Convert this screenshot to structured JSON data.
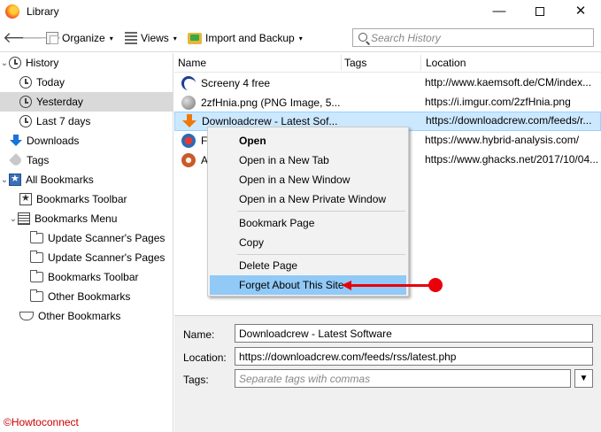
{
  "window": {
    "title": "Library",
    "min_glyph": "—",
    "close_glyph": "✕"
  },
  "toolbar": {
    "back_glyph": "🡐",
    "forward_glyph": "🡒",
    "organize_label": "Organize",
    "views_label": "Views",
    "import_label": "Import and Backup",
    "caret": "▾",
    "search_placeholder": "Search History"
  },
  "sidebar": {
    "items": [
      {
        "label": "History"
      },
      {
        "label": "Today"
      },
      {
        "label": "Yesterday"
      },
      {
        "label": "Last 7 days"
      },
      {
        "label": "Downloads"
      },
      {
        "label": "Tags"
      },
      {
        "label": "All Bookmarks"
      },
      {
        "label": "Bookmarks Toolbar"
      },
      {
        "label": "Bookmarks Menu"
      },
      {
        "label": "Update Scanner's Pages"
      },
      {
        "label": "Update Scanner's Pages"
      },
      {
        "label": "Bookmarks Toolbar"
      },
      {
        "label": "Other Bookmarks"
      },
      {
        "label": "Other Bookmarks"
      }
    ],
    "selected": "Yesterday"
  },
  "list": {
    "columns": [
      "Name",
      "Tags",
      "Location"
    ],
    "rows": [
      {
        "name": "Screeny 4 free",
        "tags": "",
        "location": "http://www.kaemsoft.de/CM/index...",
        "icon": "screeny-favicon"
      },
      {
        "name": "2zfHnia.png (PNG Image, 5...",
        "tags": "",
        "location": "https://i.imgur.com/2zfHnia.png",
        "icon": "globe-favicon"
      },
      {
        "name": "Downloadcrew - Latest Sof...",
        "tags": "",
        "location": "https://downloadcrew.com/feeds/r...",
        "icon": "downloadcrew-favicon"
      },
      {
        "name": "F",
        "tags": "",
        "location": "https://www.hybrid-analysis.com/",
        "icon": "hybrid-analysis-favicon"
      },
      {
        "name": "A",
        "tags": "",
        "location": "https://www.ghacks.net/2017/10/04...",
        "icon": "ghacks-favicon"
      }
    ],
    "selected_row": 2
  },
  "context_menu": {
    "items": [
      {
        "label": "Open"
      },
      {
        "label": "Open in a New Tab"
      },
      {
        "label": "Open in a New Window"
      },
      {
        "label": "Open in a New Private Window"
      },
      {
        "label": "Bookmark Page"
      },
      {
        "label": "Copy"
      },
      {
        "label": "Delete Page"
      },
      {
        "label": "Forget About This Site"
      }
    ],
    "active_item": "Forget About This Site"
  },
  "details": {
    "name_label": "Name:",
    "name_value": "Downloadcrew - Latest Software",
    "location_label": "Location:",
    "location_value": "https://downloadcrew.com/feeds/rss/latest.php",
    "tags_label": "Tags:",
    "tags_value": "",
    "tags_placeholder": "Separate tags with commas"
  },
  "annotation": {
    "color": "#e8000b"
  },
  "watermark": "©Howtoconnect",
  "colors": {
    "selection_row": "#cce8ff",
    "menu_highlight": "#91c9f7",
    "tree_selected": "#d9d9d9"
  }
}
